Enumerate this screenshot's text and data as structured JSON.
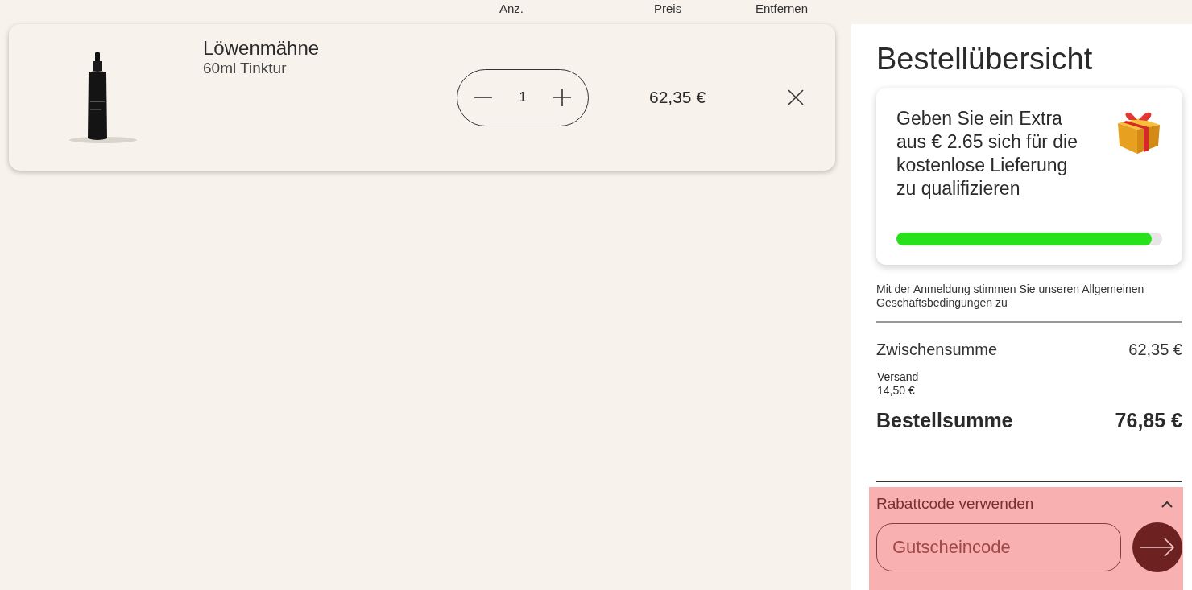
{
  "columns": [
    "Anz.",
    "Preis",
    "Entfernen"
  ],
  "cart_items": [
    {
      "kind": "picture",
      "name": "Löwenmähne",
      "variant": "60ml Tinktur",
      "quantity": "1",
      "price": "62,35 €"
    }
  ],
  "summary": {
    "title": "Bestellübersicht",
    "free_shipping": {
      "message": "Geben Sie ein Extra aus € 2.65 sich für die kostenlose Lieferung zu qualifizieren",
      "level": 0.96
    },
    "terms": "Mit der Anmeldung stimmen Sie unseren Allgemeinen Geschäftsbedingungen zu",
    "subtotal": {
      "label": "Zwischensumme",
      "value": "62,35 €"
    },
    "shipping": {
      "label": "Versand",
      "value": "14,50 €"
    },
    "total": {
      "label": "Bestellsumme",
      "value": "76,85 €"
    },
    "coupon": {
      "label": "Rabattcode verwenden",
      "expanded": true,
      "placeholder": "Gutscheincode"
    }
  }
}
